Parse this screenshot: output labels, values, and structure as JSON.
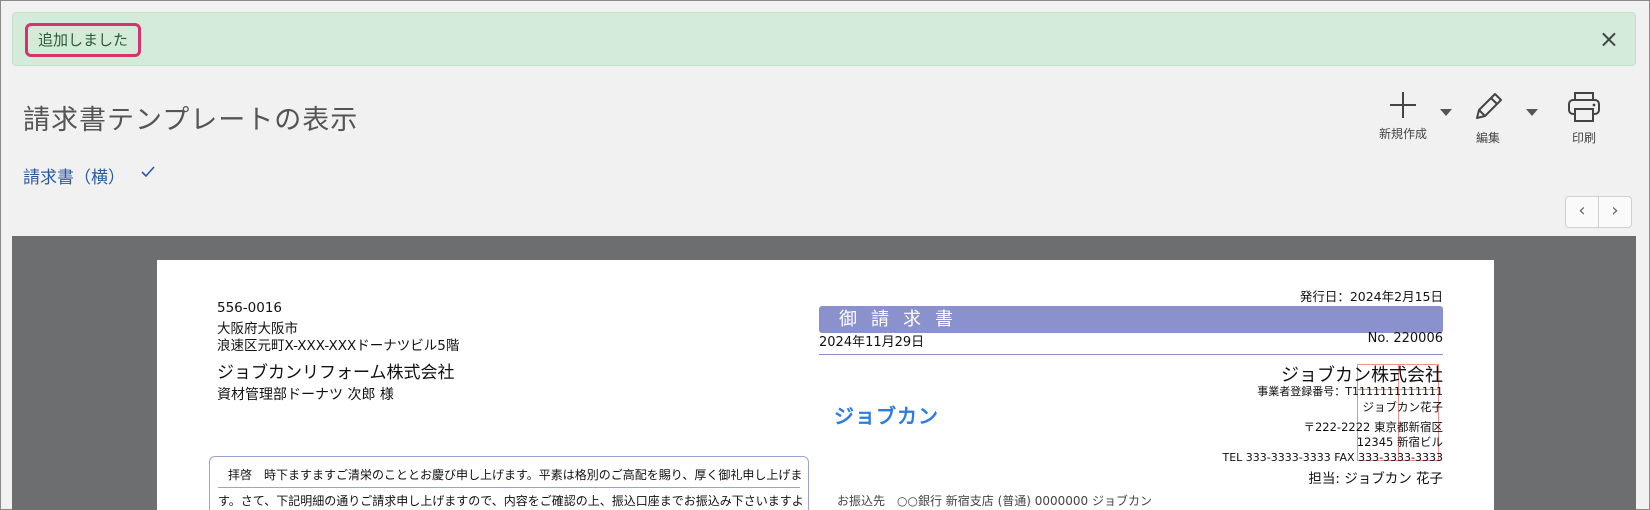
{
  "alert": {
    "message": "追加しました",
    "close_glyph": "×"
  },
  "header": {
    "title": "請求書テンプレートの表示",
    "template_name": "請求書（横）"
  },
  "toolbar": {
    "new_label": "新規作成",
    "edit_label": "編集",
    "print_label": "印刷"
  },
  "pager": {
    "prev_glyph": "‹",
    "next_glyph": "›"
  },
  "invoice": {
    "client": {
      "postal": "556-0016",
      "city": "大阪府大阪市",
      "street": "浪速区元町X-XXX-XXXドーナツビル5階",
      "company": "ジョブカンリフォーム株式会社",
      "contact": "資材管理部ドーナツ 次郎 様"
    },
    "issue_date": "発行日：2024年2月15日",
    "title": "御請求書",
    "invoice_date": "2024年11月29日",
    "number": "No. 220006",
    "logo": "ジョブカン",
    "issuer": {
      "company": "ジョブカン株式会社",
      "registration": "事業者登録番号：T1111111111111",
      "person": "ジョブカン花子",
      "postal_addr": "〒222-2222 東京都新宿区",
      "building": "12345 新宿ビル",
      "tel_fax": "TEL 333-3333-3333 FAX 333-3333-3333",
      "rep": "担当: ジョブカン 花子"
    },
    "greeting_line1": "拝啓　時下ますますご清栄のこととお慶び申し上げます。平素は格別のご高配を賜り、厚く御礼申し上げま",
    "greeting_line2": "す。さて、下記明細の通りご請求申し上げますので、内容をご確認の上、振込口座までお振込み下さいますよ",
    "bank_partial": "お振込先　○○銀行 新宿支店 (普通) 0000000 ジョブカン"
  },
  "colors": {
    "alert_bg": "#d4ebd9",
    "alert_highlight": "#d6326e",
    "link": "#2c5aa0",
    "invoice_bar": "#8b91cc",
    "logo": "#2d7ce0",
    "preview_bg": "#6c6e70"
  },
  "icons": [
    "close-icon",
    "check-icon",
    "plus-icon",
    "pencil-icon",
    "printer-icon",
    "chevron-down-icon",
    "chevron-left-icon",
    "chevron-right-icon"
  ]
}
